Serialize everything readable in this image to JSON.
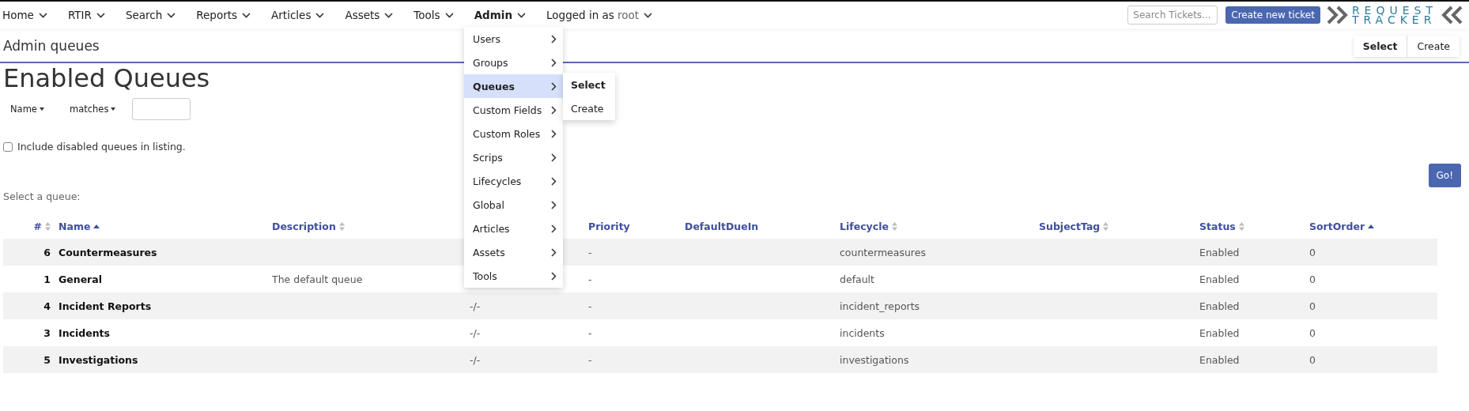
{
  "nav": {
    "items": [
      {
        "label": "Home",
        "selected": false
      },
      {
        "label": "RTIR",
        "selected": false
      },
      {
        "label": "Search",
        "selected": false
      },
      {
        "label": "Reports",
        "selected": false
      },
      {
        "label": "Articles",
        "selected": false
      },
      {
        "label": "Assets",
        "selected": false
      },
      {
        "label": "Tools",
        "selected": false
      },
      {
        "label": "Admin",
        "selected": true
      }
    ],
    "user": {
      "prefix": "Logged in as",
      "name": "root"
    },
    "search": {
      "placeholder": "Search Tickets..."
    },
    "create_button": "Create new ticket",
    "logo": {
      "line1": "REQUEST",
      "line2": "TRACKER"
    }
  },
  "page": {
    "title": "Admin queues",
    "tabs": [
      {
        "label": "Select",
        "selected": true
      },
      {
        "label": "Create",
        "selected": false
      }
    ]
  },
  "heading": "Enabled Queues",
  "filter": {
    "field": "Name",
    "operator": "matches"
  },
  "include_disabled": {
    "label": "Include disabled queues in listing.",
    "checked": false
  },
  "go_button": "Go!",
  "prompt": "Select a queue:",
  "table": {
    "columns": [
      {
        "label": "#",
        "sorted_ascending": false
      },
      {
        "label": "Name",
        "sorted_ascending": true
      },
      {
        "label": "Description",
        "sorted_ascending": false
      },
      null,
      {
        "label": "Priority"
      },
      {
        "label": "DefaultDueIn"
      },
      {
        "label": "Lifecycle",
        "sorted_ascending": false
      },
      {
        "label": "SubjectTag",
        "sorted_ascending": false
      },
      {
        "label": "Status",
        "sorted_ascending": false
      },
      {
        "label": "SortOrder",
        "sorted_ascending": true
      }
    ],
    "rows": [
      {
        "id": "6",
        "name": "Countermeasures",
        "priority": "-",
        "lifecycle": "countermeasures",
        "status": "Enabled",
        "sort_order": "0"
      },
      {
        "id": "1",
        "name": "General",
        "description": "The default queue",
        "priority": "-",
        "lifecycle": "default",
        "status": "Enabled",
        "sort_order": "0"
      },
      {
        "id": "4",
        "name": "Incident Reports",
        "column_4": "-/-",
        "priority": "-",
        "lifecycle": "incident_reports",
        "status": "Enabled",
        "sort_order": "0"
      },
      {
        "id": "3",
        "name": "Incidents",
        "column_4": "-/-",
        "priority": "-",
        "lifecycle": "incidents",
        "status": "Enabled",
        "sort_order": "0"
      },
      {
        "id": "5",
        "name": "Investigations",
        "column_4": "-/-",
        "priority": "-",
        "lifecycle": "investigations",
        "status": "Enabled",
        "sort_order": "0"
      }
    ]
  },
  "admin_menu": {
    "items": [
      {
        "label": "Users",
        "selected": false
      },
      {
        "label": "Groups",
        "selected": false
      },
      {
        "label": "Queues",
        "selected": true
      },
      {
        "label": "Custom Fields",
        "selected": false
      },
      {
        "label": "Custom Roles",
        "selected": false
      },
      {
        "label": "Scrips",
        "selected": false
      },
      {
        "label": "Lifecycles",
        "selected": false
      },
      {
        "label": "Global",
        "selected": false
      },
      {
        "label": "Articles",
        "selected": false
      },
      {
        "label": "Assets",
        "selected": false
      },
      {
        "label": "Tools",
        "selected": false
      }
    ],
    "submenu": [
      {
        "label": "Select",
        "selected": true
      },
      {
        "label": "Create",
        "selected": false
      }
    ]
  }
}
